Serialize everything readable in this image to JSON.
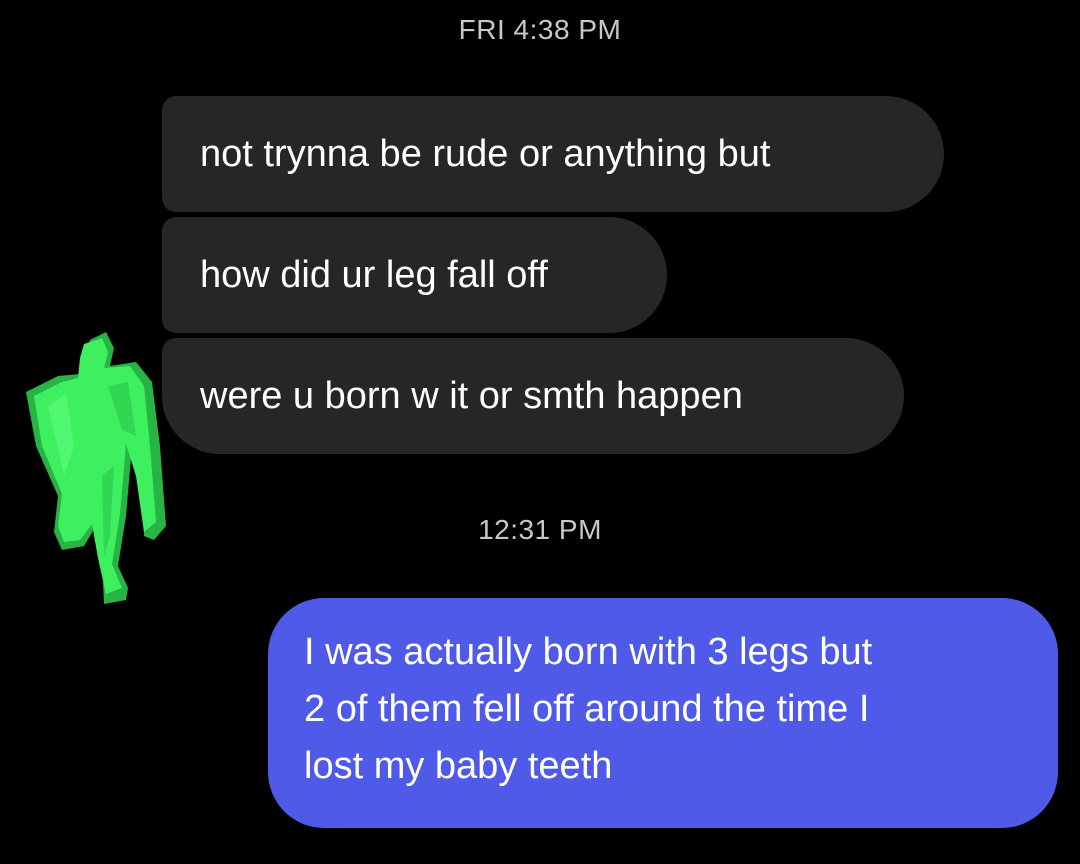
{
  "conversation": {
    "timestamps": {
      "first": "FRI 4:38 PM",
      "second": "12:31 PM"
    },
    "incoming": [
      {
        "text": "not trynna be rude or anything but"
      },
      {
        "text": "how did ur leg fall off"
      },
      {
        "text": "were u born w it or smth happen"
      }
    ],
    "outgoing": {
      "lines": [
        "I was actually born with 3 legs but",
        "2 of them fell off around the time I",
        "lost my baby teeth"
      ]
    },
    "sender_avatar": {
      "icon": "green-figure-icon",
      "color": "#3ef060"
    }
  },
  "colors": {
    "background": "#000000",
    "incoming_bubble": "#262626",
    "outgoing_bubble": "#4f5ae8",
    "timestamp_text": "#c8c8c8"
  }
}
